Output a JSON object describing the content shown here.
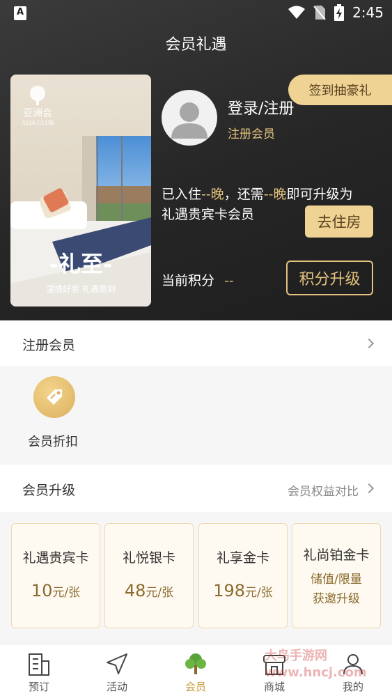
{
  "status_bar": {
    "time": "2:45",
    "app_icon": "A"
  },
  "header": {
    "title": "会员礼遇"
  },
  "hotel_card": {
    "brand_cn": "亚洲会",
    "brand_en": "ASIA CLUB",
    "headline": "-礼至-",
    "tagline": "温情好客 礼遇周到"
  },
  "profile": {
    "login_label": "登录/注册",
    "register_sub": "注册会员",
    "checkin_button": "签到抽豪礼"
  },
  "upgrade": {
    "line1_a": "已入住",
    "line1_b": "--晚",
    "line1_c": "，还需",
    "line1_d": "--晚",
    "line1_e": "即可升级为",
    "line2": "礼遇贵宾卡会员",
    "stay_button": "去住房"
  },
  "points": {
    "label": "当前积分",
    "value": "--",
    "upgrade_button": "积分升级"
  },
  "register_row": {
    "label": "注册会员"
  },
  "discount": {
    "label": "会员折扣"
  },
  "upgrade_row": {
    "label": "会员升级",
    "compare": "会员权益对比"
  },
  "tiers": [
    {
      "name": "礼遇贵宾卡",
      "price": "10",
      "unit": "元/张"
    },
    {
      "name": "礼悦银卡",
      "price": "48",
      "unit": "元/张"
    },
    {
      "name": "礼享金卡",
      "price": "198",
      "unit": "元/张"
    },
    {
      "name": "礼尚铂金卡",
      "note1": "储值/限量",
      "note2": "获邀升级"
    }
  ],
  "tabbar": [
    {
      "label": "预订",
      "icon": "building-icon"
    },
    {
      "label": "活动",
      "icon": "navigation-icon"
    },
    {
      "label": "会员",
      "icon": "tree-icon",
      "active": true
    },
    {
      "label": "商城",
      "icon": "store-icon"
    },
    {
      "label": "我的",
      "icon": "user-icon"
    }
  ],
  "colors": {
    "gold": "#e3c27e",
    "gold_button": "#efd394",
    "dark_bg": "#262626",
    "active_tab": "#c99a3a"
  },
  "watermark": "大鸟手游网 www.hncj.com"
}
